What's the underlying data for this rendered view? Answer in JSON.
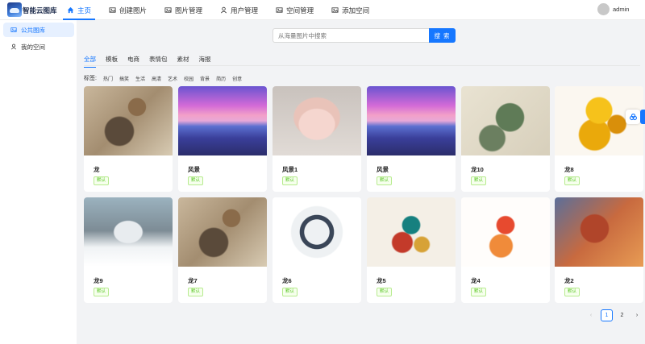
{
  "header": {
    "brand": "智能云图库",
    "nav": [
      {
        "label": "主页",
        "icon": "home-icon",
        "active": true
      },
      {
        "label": "创建图片",
        "icon": "image-icon"
      },
      {
        "label": "图片管理",
        "icon": "image-icon"
      },
      {
        "label": "用户管理",
        "icon": "user-icon"
      },
      {
        "label": "空间管理",
        "icon": "image-icon"
      },
      {
        "label": "添加空间",
        "icon": "image-icon"
      }
    ],
    "username": "admin"
  },
  "sidebar": {
    "items": [
      {
        "label": "公共图库",
        "icon": "picture-icon",
        "active": true
      },
      {
        "label": "我的空间",
        "icon": "user-icon"
      }
    ]
  },
  "search": {
    "placeholder": "从海量图片中搜索",
    "button": "搜 索"
  },
  "categories": [
    "全部",
    "模板",
    "电商",
    "表情包",
    "素材",
    "海报"
  ],
  "tags": {
    "label": "标签:",
    "items": [
      "热门",
      "搞笑",
      "生活",
      "高清",
      "艺术",
      "校园",
      "背景",
      "简历",
      "创意"
    ]
  },
  "cards": [
    {
      "name": "龙",
      "tag": "默认",
      "image": "dragon-a"
    },
    {
      "name": "风景",
      "tag": "默认",
      "image": "lake"
    },
    {
      "name": "风景1",
      "tag": "默认",
      "image": "pig"
    },
    {
      "name": "风景",
      "tag": "默认",
      "image": "lake"
    },
    {
      "name": "龙10",
      "tag": "默认",
      "image": "dragon-green"
    },
    {
      "name": "龙8",
      "tag": "默认",
      "image": "dragon-gold"
    },
    {
      "name": "龙9",
      "tag": "默认",
      "image": "dragon-white"
    },
    {
      "name": "龙7",
      "tag": "默认",
      "image": "dragon-a"
    },
    {
      "name": "龙6",
      "tag": "默认",
      "image": "dragon-ink"
    },
    {
      "name": "龙5",
      "tag": "默认",
      "image": "dragon-color"
    },
    {
      "name": "龙4",
      "tag": "默认",
      "image": "dragon-red"
    },
    {
      "name": "龙2",
      "tag": "默认",
      "image": "dragon-fire"
    }
  ],
  "pagination": {
    "prev": "‹",
    "pages": [
      "1",
      "2"
    ],
    "current": "1",
    "next": "›"
  },
  "colors": {
    "accent": "#1677ff",
    "tag_green": "#52c41a"
  }
}
